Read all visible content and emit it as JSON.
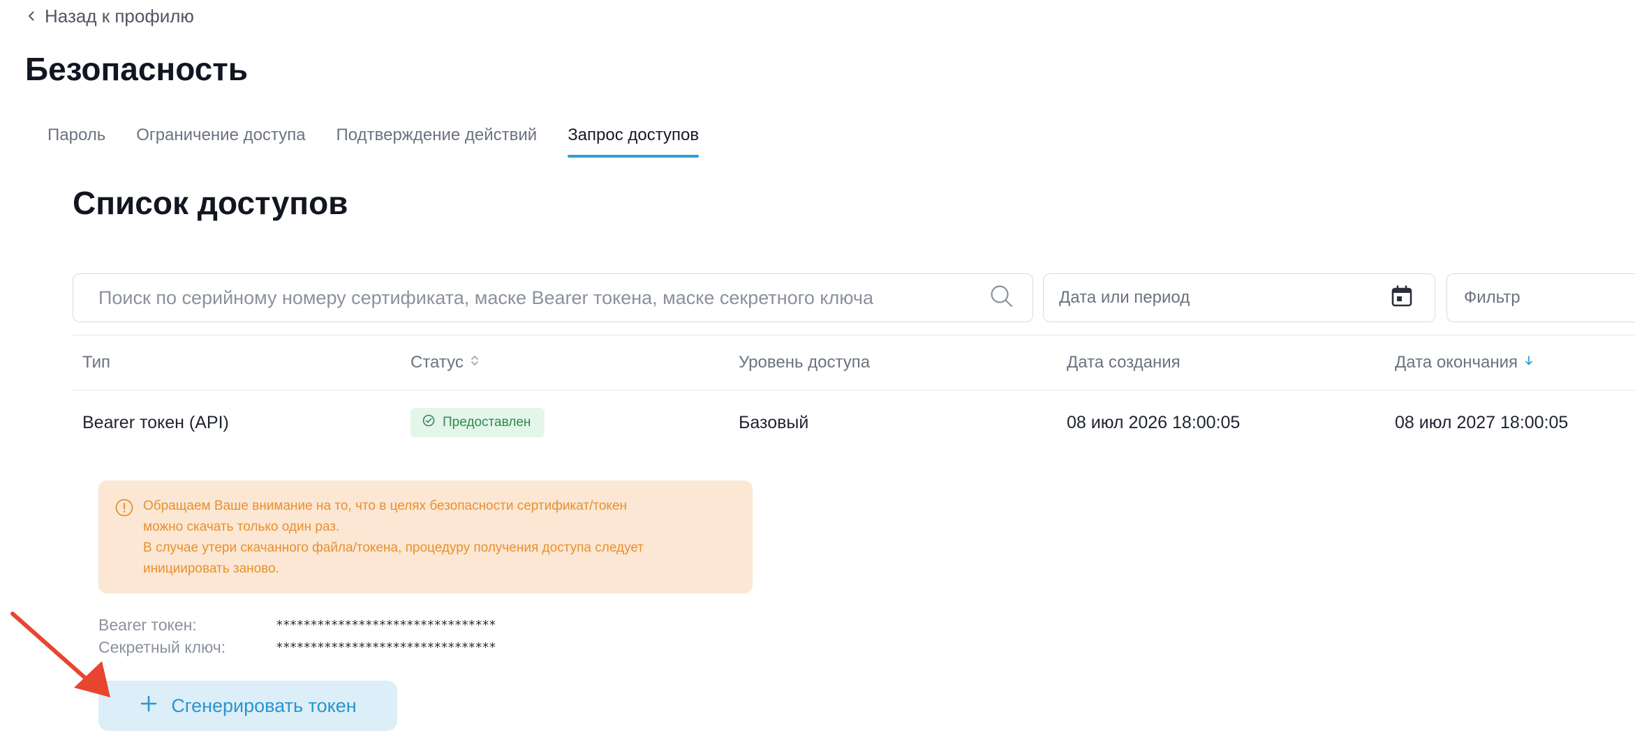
{
  "back_link": {
    "label": "Назад к профилю",
    "icon": "chevron-left-icon"
  },
  "page_title": "Безопасность",
  "tabs": [
    {
      "label": "Пароль",
      "active": false
    },
    {
      "label": "Ограничение доступа",
      "active": false
    },
    {
      "label": "Подтверждение действий",
      "active": false
    },
    {
      "label": "Запрос доступов",
      "active": true
    }
  ],
  "section_title": "Список доступов",
  "filters": {
    "search_placeholder": "Поиск по серийному номеру сертификата, маске Bearer токена, маске секретного ключа",
    "date_placeholder": "Дата или период",
    "filter_placeholder": "Фильтр"
  },
  "table": {
    "columns": [
      {
        "label": "Тип",
        "sort": "none"
      },
      {
        "label": "Статус",
        "sort": "sortable"
      },
      {
        "label": "Уровень доступа",
        "sort": "none"
      },
      {
        "label": "Дата создания",
        "sort": "none"
      },
      {
        "label": "Дата окончания",
        "sort": "descending"
      }
    ],
    "rows": [
      {
        "type": "Bearer токен (API)",
        "status": "Предоставлен",
        "access_level": "Базовый",
        "created": "08 июл 2026 18:00:05",
        "expires": "08 июл 2027 18:00:05"
      }
    ]
  },
  "warning": {
    "lines": [
      "Обращаем Ваше внимание на то, что в целях безопасности сертификат/токен",
      "можно скачать только один раз.",
      "В случае утери скачанного файла/токена, процедуру получения доступа следует",
      "инициировать заново."
    ]
  },
  "token_fields": {
    "bearer_label": "Bearer токен:",
    "bearer_value": "********************************",
    "secret_label": "Секретный ключ:",
    "secret_value": "********************************"
  },
  "generate_button": {
    "label": "Сгенерировать токен",
    "icon": "plus-icon"
  },
  "colors": {
    "accent": "#2d9fd6",
    "status_success_bg": "#e4f5ea",
    "status_success_text": "#2f8a4f",
    "warning_bg": "#fbe7d3",
    "warning_text": "#e8902f",
    "button_bg": "#dceef8",
    "annotation_arrow": "#e8452f"
  }
}
